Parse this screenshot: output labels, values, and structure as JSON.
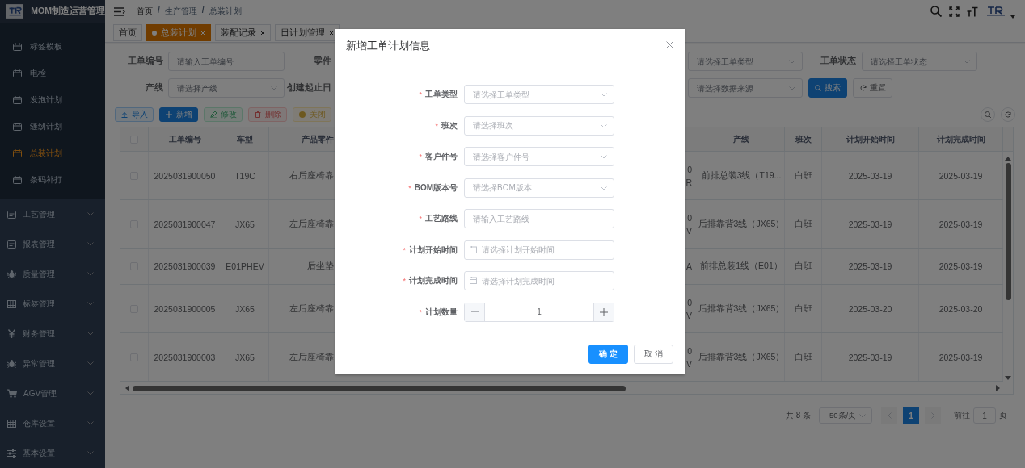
{
  "sidebar": {
    "title": "MOM制造运营管理",
    "sub_items": [
      {
        "label": "标签模板",
        "selected": false
      },
      {
        "label": "电检",
        "selected": false
      },
      {
        "label": "发泡计划",
        "selected": false
      },
      {
        "label": "缝纫计划",
        "selected": false
      },
      {
        "label": "总装计划",
        "selected": true
      },
      {
        "label": "条码补打",
        "selected": false
      }
    ],
    "groups": [
      {
        "label": "工艺管理",
        "expanded": false
      },
      {
        "label": "报表管理",
        "expanded": false
      },
      {
        "label": "质量管理",
        "expanded": false
      },
      {
        "label": "标签管理",
        "expanded": false
      },
      {
        "label": "财务管理",
        "expanded": false
      },
      {
        "label": "异常管理",
        "expanded": false
      },
      {
        "label": "AGV管理",
        "expanded": false
      },
      {
        "label": "仓库设置",
        "expanded": false
      },
      {
        "label": "基本设置",
        "expanded": false
      }
    ]
  },
  "breadcrumb": [
    "首页",
    "生产管理",
    "总装计划"
  ],
  "breadcrumb_separator": "/",
  "tabs": [
    {
      "label": "首页",
      "selected": false,
      "closable": false
    },
    {
      "label": "总装计划",
      "selected": true,
      "closable": true
    },
    {
      "label": "装配记录",
      "selected": false,
      "closable": true
    },
    {
      "label": "日计划管理",
      "selected": false,
      "closable": true
    }
  ],
  "filters": {
    "order_no_label": "工单编号",
    "order_no_placeholder": "请输入工单编号",
    "part_label": "零件",
    "order_type_placeholder": "请选择工单类型",
    "status_label": "工单状态",
    "status_placeholder": "请选择工单状态",
    "line_label": "产线",
    "line_placeholder": "请选择产线",
    "date_label": "创建起止日",
    "source_placeholder": "请选择数据来源",
    "search_button": "搜索",
    "reset_button": "重置"
  },
  "toolbar": [
    {
      "label": "导入",
      "kind": "import",
      "disabled": false
    },
    {
      "label": "新增",
      "kind": "add",
      "disabled": false
    },
    {
      "label": "修改",
      "kind": "edit",
      "disabled": true
    },
    {
      "label": "删除",
      "kind": "delete",
      "disabled": true
    },
    {
      "label": "关闭",
      "kind": "close",
      "disabled": true
    }
  ],
  "table": {
    "all_checked": false,
    "columns": [
      "工单编号",
      "车型",
      "产品零件",
      "产线",
      "班次",
      "计划开始时间",
      "计划完成时间"
    ],
    "rows": [
      {
        "checked": false,
        "order_no": "2025031900050",
        "model": "T19C",
        "part": "右后座椅靠",
        "column_5": [
          "0",
          "R"
        ],
        "line": "前排总装3线（T19...",
        "shift": "白班",
        "start": "2025-03-19",
        "end": "2025-03-19"
      },
      {
        "checked": false,
        "order_no": "2025031900047",
        "model": "JX65",
        "part": "左后座椅靠",
        "column_5": [
          "0",
          "V"
        ],
        "line": "后排靠背3线（JX65）",
        "shift": "白班",
        "start": "2025-03-19",
        "end": "2025-03-19"
      },
      {
        "checked": false,
        "order_no": "2025031900039",
        "model": "E01PHEV",
        "part": "后坐垫",
        "column_5": [
          "A"
        ],
        "line": "前排总装1线（E01）",
        "shift": "白班",
        "start": "2025-03-19",
        "end": "2025-03-19"
      },
      {
        "checked": false,
        "order_no": "2025031900005",
        "model": "JX65",
        "part": "左后座椅靠",
        "column_5": [
          "0",
          "V"
        ],
        "line": "后排靠背3线（JX65）",
        "shift": "白班",
        "start": "2025-03-20",
        "end": "2025-03-20"
      },
      {
        "checked": false,
        "order_no": "2025031900003",
        "model": "JX65",
        "part": "左后座椅靠",
        "column_5": [
          "0",
          "V"
        ],
        "line": "后排靠背3线（JX65）",
        "shift": "白班",
        "start": "2025-03-19",
        "end": "2025-03-19"
      }
    ]
  },
  "pagination": {
    "total": "共 8 条",
    "page_size": "50条/页",
    "pages": [
      {
        "label": "1",
        "selected": true
      }
    ],
    "goto_label": "前往",
    "goto_value": "1",
    "page_suffix": "页"
  },
  "dialog": {
    "title": "新增工单计划信息",
    "required_mark": "*",
    "fields": [
      {
        "label": "工单类型",
        "kind": "select",
        "required": true,
        "placeholder": "请选择工单类型"
      },
      {
        "label": "班次",
        "kind": "select",
        "required": true,
        "placeholder": "请选择班次"
      },
      {
        "label": "客户件号",
        "kind": "select",
        "required": true,
        "placeholder": "请选择客户件号"
      },
      {
        "label": "BOM版本号",
        "kind": "select",
        "required": true,
        "placeholder": "请选择BOM版本"
      },
      {
        "label": "工艺路线",
        "kind": "input",
        "required": true,
        "placeholder": "请输入工艺路线"
      },
      {
        "label": "计划开始时间",
        "kind": "date",
        "required": true,
        "placeholder": "请选择计划开始时间"
      },
      {
        "label": "计划完成时间",
        "kind": "date",
        "required": true,
        "placeholder": "请选择计划完成时间"
      },
      {
        "label": "计划数量",
        "kind": "number",
        "required": true,
        "value": "1"
      }
    ],
    "buttons": [
      {
        "label": "确 定",
        "kind": "confirm"
      },
      {
        "label": "取 消",
        "kind": "cancel"
      }
    ]
  }
}
